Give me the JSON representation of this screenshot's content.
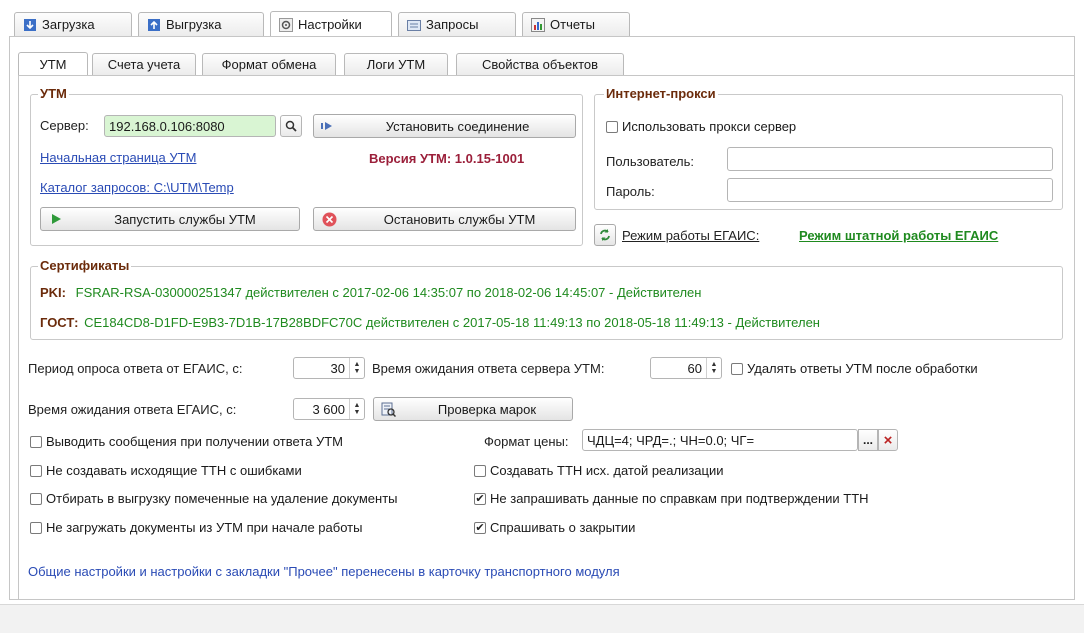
{
  "top_tabs": [
    {
      "label": "Загрузка",
      "icon": "download-icon"
    },
    {
      "label": "Выгрузка",
      "icon": "upload-icon"
    },
    {
      "label": "Настройки",
      "icon": "settings-icon"
    },
    {
      "label": "Запросы",
      "icon": "requests-icon"
    },
    {
      "label": "Отчеты",
      "icon": "reports-icon"
    }
  ],
  "sub_tabs": [
    "УТМ",
    "Счета учета",
    "Формат обмена",
    "Логи УТМ",
    "Свойства объектов"
  ],
  "utm_group": {
    "title": "УТМ",
    "server_label": "Сервер:",
    "server_value": "192.168.0.106:8080",
    "connect_button": "Установить соединение",
    "start_page_link": "Начальная страница УТМ",
    "version_text": "Версия УТМ: 1.0.15-1001",
    "catalog_link": "Каталог запросов: C:\\UTM\\Temp",
    "start_services_button": "Запустить службы УТМ",
    "stop_services_button": "Остановить службы УТМ"
  },
  "proxy_group": {
    "title": "Интернет-прокси",
    "use_proxy_label": "Использовать прокси сервер",
    "user_label": "Пользователь:",
    "password_label": "Пароль:",
    "user_value": "",
    "password_value": ""
  },
  "egais_mode": {
    "label": "Режим работы ЕГАИС:",
    "value": "Режим штатной работы ЕГАИС"
  },
  "certs_group": {
    "title": "Сертификаты",
    "pki_label": "PKI:",
    "pki_id": "FSRAR-RSA-030000251347",
    "pki_text": " действителен с 2017-02-06 14:35:07 по 2018-02-06 14:45:07 - Действителен",
    "gost_label": "ГОСТ:",
    "gost_id": "CE184CD8-D1FD-E9B3-7D1B-17B28BDFC70C",
    "gost_text": " действителен с 2017-05-18 11:49:13 по 2018-05-18 11:49:13 - Действителен"
  },
  "settings": {
    "poll_label": "Период опроса ответа от ЕГАИС, с:",
    "poll_value": "30",
    "utm_wait_label": "Время ожидания ответа сервера УТМ:",
    "utm_wait_value": "60",
    "delete_answers_label": "Удалять ответы УТМ после обработки",
    "egais_wait_label": "Время ожидания ответа ЕГАИС, с:",
    "egais_wait_value": "3 600",
    "check_marks_button": "Проверка марок",
    "price_format_label": "Формат цены:",
    "price_format_value": "ЧДЦ=4; ЧРД=.; ЧН=0.0; ЧГ=",
    "price_dots": "...",
    "price_clear": "×"
  },
  "checkboxes": [
    {
      "label": "Выводить сообщения при получении ответа УТМ",
      "checked": false
    },
    {
      "label": "Не создавать исходящие ТТН с ошибками",
      "checked": false
    },
    {
      "label": "Отбирать в выгрузку помеченные на удаление документы",
      "checked": false
    },
    {
      "label": "Не загружать документы из УТМ при начале работы",
      "checked": false
    },
    {
      "label": "Создавать ТТН исх. датой реализации",
      "checked": false
    },
    {
      "label": "Не запрашивать данные по справкам при подтверждении ТТН",
      "checked": true
    },
    {
      "label": "Спрашивать о закрытии",
      "checked": true
    }
  ],
  "footer_note": "Общие настройки и настройки с закладки \"Прочее\" перенесены в карточку транспортного модуля",
  "colors": {
    "accent_link": "#2a4bb5",
    "group_title": "#6b2b0b",
    "version": "#9b1f3a",
    "cert_green": "#1f8a1f",
    "server_bg": "#d9f5d3"
  }
}
